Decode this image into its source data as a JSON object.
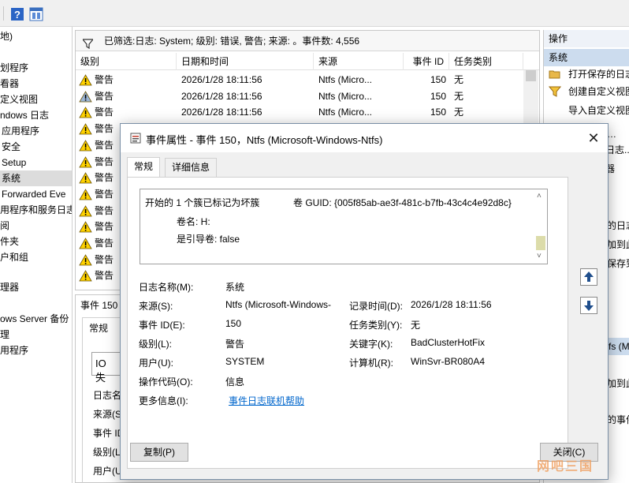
{
  "toolbar": {
    "help_icon": "help-icon",
    "properties_icon": "console-icon"
  },
  "tree": {
    "items": [
      {
        "label": "地)"
      },
      {
        "label": ""
      },
      {
        "label": "划程序"
      },
      {
        "label": "看器"
      },
      {
        "label": "定义视图"
      },
      {
        "label": "ndows 日志"
      },
      {
        "label": "应用程序"
      },
      {
        "label": "安全"
      },
      {
        "label": "Setup"
      },
      {
        "label": "系统"
      },
      {
        "label": "Forwarded Eve"
      },
      {
        "label": "用程序和服务日志"
      },
      {
        "label": "阅"
      },
      {
        "label": "件夹"
      },
      {
        "label": "户和组"
      },
      {
        "label": ""
      },
      {
        "label": "理器"
      },
      {
        "label": ""
      },
      {
        "label": "ows Server 备份"
      },
      {
        "label": "理"
      },
      {
        "label": "用程序"
      }
    ]
  },
  "list": {
    "filter_text": "已筛选:日志: System; 级别: 错误, 警告; 来源: 。事件数: 4,556",
    "columns": {
      "level": "级别",
      "datetime": "日期和时间",
      "source": "来源",
      "event_id": "事件 ID",
      "task": "任务类别"
    },
    "rows": [
      {
        "level": "警告",
        "datetime": "2026/1/28 18:11:56",
        "source": "Ntfs (Micro...",
        "event_id": "150",
        "task": "无"
      },
      {
        "level": "警告",
        "datetime": "2026/1/28 18:11:56",
        "source": "Ntfs (Micro...",
        "event_id": "150",
        "task": "无"
      },
      {
        "level": "警告",
        "datetime": "2026/1/28 18:11:56",
        "source": "Ntfs (Micro...",
        "event_id": "150",
        "task": "无"
      },
      {
        "level": "警告"
      },
      {
        "level": "警告"
      },
      {
        "level": "警告"
      },
      {
        "level": "警告"
      },
      {
        "level": "警告"
      },
      {
        "level": "警告"
      },
      {
        "level": "警告"
      },
      {
        "level": "警告"
      },
      {
        "level": "警告"
      },
      {
        "level": "警告"
      }
    ]
  },
  "lower": {
    "title": "事件 150",
    "tab": "常规",
    "io_text": "IO 失",
    "labels": [
      "日志名",
      "来源(S",
      "事件 ID",
      "级别(L",
      "用户(U"
    ]
  },
  "actions": {
    "header": "操作",
    "section": "系统",
    "items": [
      {
        "label": "打开保存的日志"
      },
      {
        "label": "创建自定义视图"
      },
      {
        "label": "导入自定义视图"
      }
    ],
    "partial": [
      "…",
      "日志...",
      "器",
      "的日志",
      "加到此",
      "保存到",
      "fs (M",
      "加到此",
      "的事件",
      "的"
    ]
  },
  "dialog": {
    "title": "事件属性 - 事件 150，Ntfs (Microsoft-Windows-Ntfs)",
    "close": "✕",
    "tabs": [
      "常规",
      "详细信息"
    ],
    "description": {
      "line1a": "开始的 1 个簇已标记为坏簇",
      "line1b": "卷 GUID: {005f85ab-ae3f-481c-b7fb-43c4c4e92d8c}",
      "line2": "卷名: H:",
      "line3": "是引导卷: false"
    },
    "fields": {
      "log_name_label": "日志名称(M):",
      "log_name": "系统",
      "source_label": "来源(S):",
      "source": "Ntfs (Microsoft-Windows-",
      "logged_label": "记录时间(D):",
      "logged": "2026/1/28 18:11:56",
      "event_id_label": "事件 ID(E):",
      "event_id": "150",
      "task_label": "任务类别(Y):",
      "task": "无",
      "level_label": "级别(L):",
      "level": "警告",
      "keywords_label": "关键字(K):",
      "keywords": "BadClusterHotFix",
      "user_label": "用户(U):",
      "user": "SYSTEM",
      "computer_label": "计算机(R):",
      "computer": "WinSvr-BR080A4",
      "opcode_label": "操作代码(O):",
      "opcode": "信息",
      "more_info_label": "更多信息(I):",
      "more_info_link": "事件日志联机帮助"
    },
    "buttons": {
      "copy": "复制(P)",
      "close": "关闭(C)"
    },
    "watermark": "网吧三国"
  },
  "colors": {
    "selection": "#dcdcdc",
    "header_blue": "#ccdcee",
    "link": "#0066cc",
    "warning": "#ffd200"
  }
}
